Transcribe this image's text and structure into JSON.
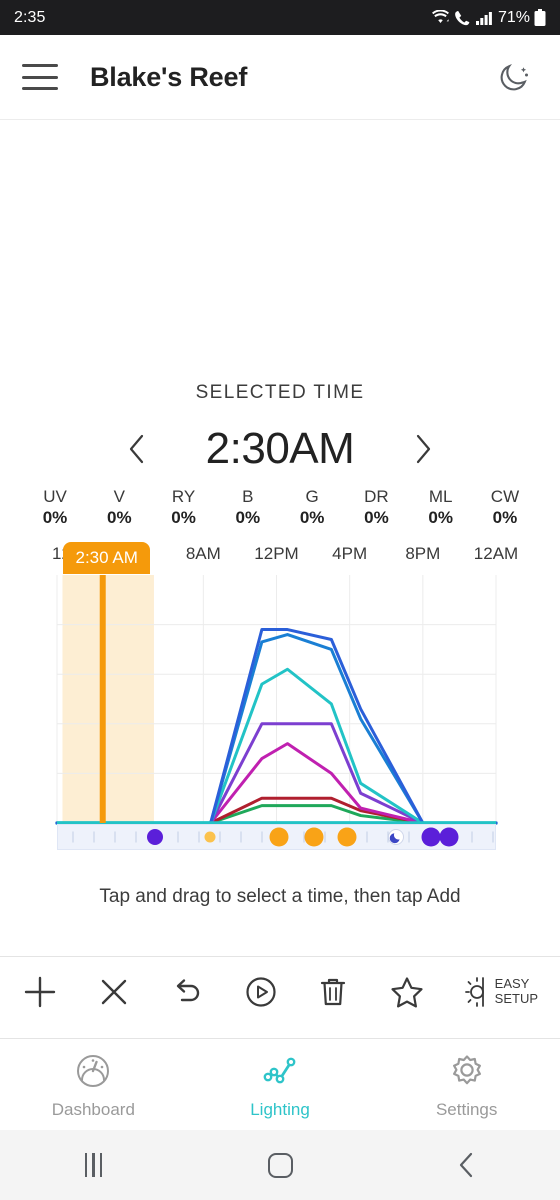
{
  "status_bar": {
    "time": "2:35",
    "battery_pct": "71%",
    "icons": [
      "wifi-icon",
      "call-icon",
      "signal-icon",
      "battery-icon"
    ]
  },
  "app_bar": {
    "menu_icon": "hamburger-menu-icon",
    "title": "Blake's Reef",
    "theme_icon": "moon-icon"
  },
  "selection": {
    "label": "SELECTED TIME",
    "time": "2:30AM",
    "prev_icon": "chevron-left-icon",
    "next_icon": "chevron-right-icon",
    "tooltip": "2:30 AM"
  },
  "channels": [
    {
      "name": "UV",
      "value": "0%",
      "color": "#7c3fd0"
    },
    {
      "name": "V",
      "value": "0%",
      "color": "#9b2fc4"
    },
    {
      "name": "RY",
      "value": "0%",
      "color": "#c0203f"
    },
    {
      "name": "B",
      "value": "0%",
      "color": "#2b5fd9"
    },
    {
      "name": "G",
      "value": "0%",
      "color": "#1fa85a"
    },
    {
      "name": "DR",
      "value": "0%",
      "color": "#b01f2e"
    },
    {
      "name": "ML",
      "value": "0%",
      "color": "#1a7fd4"
    },
    {
      "name": "CW",
      "value": "0%",
      "color": "#22c3c6"
    }
  ],
  "hint_text": "Tap and drag to select a time, then tap Add",
  "toolbar": {
    "add_label": "",
    "items": [
      {
        "name": "add-button",
        "icon": "plus-icon",
        "label": ""
      },
      {
        "name": "close-button",
        "icon": "close-x-icon",
        "label": ""
      },
      {
        "name": "undo-button",
        "icon": "undo-arrow-icon",
        "label": ""
      },
      {
        "name": "preview-button",
        "icon": "play-circle-icon",
        "label": ""
      },
      {
        "name": "delete-button",
        "icon": "trash-icon",
        "label": ""
      },
      {
        "name": "favorite-button",
        "icon": "star-icon",
        "label": ""
      },
      {
        "name": "easy-setup-button",
        "icon": "brightness-icon",
        "label": "EASY SETUP"
      }
    ],
    "easy_setup_line1": "EASY",
    "easy_setup_line2": "SETUP"
  },
  "bottom_nav": {
    "active": "Lighting",
    "accent_color": "#2ec4c9",
    "items": [
      {
        "label": "Dashboard",
        "icon": "gauge-icon",
        "active": false
      },
      {
        "label": "Lighting",
        "icon": "line-chart-icon",
        "active": true
      },
      {
        "label": "Settings",
        "icon": "gear-icon",
        "active": false
      }
    ]
  },
  "android_nav": {
    "recents_icon": "recents-icon",
    "home_icon": "home-icon",
    "back_icon": "back-icon"
  },
  "chart_data": {
    "type": "line",
    "title": "",
    "xlabel": "",
    "ylabel": "",
    "xlim": [
      0,
      24
    ],
    "ylim": [
      0,
      100
    ],
    "grid": true,
    "legend": "none",
    "x_tick_labels": [
      "12...",
      "8AM",
      "12PM",
      "4PM",
      "8PM",
      "12AM"
    ],
    "x_tick_hours": [
      0,
      8,
      12,
      16,
      20,
      24
    ],
    "selected_band": {
      "start_hour": 0.3,
      "end_hour": 5.3,
      "marker_hour": 2.5,
      "color": "#fdeed3",
      "line_color": "#f59a0b"
    },
    "x": [
      0,
      8.4,
      11.2,
      12.6,
      15.0,
      16.6,
      20.0,
      24
    ],
    "series": [
      {
        "name": "B",
        "color": "#2b5fd9",
        "values": [
          0,
          0,
          78,
          78,
          74,
          46,
          0,
          0
        ]
      },
      {
        "name": "ML",
        "color": "#1a7fd4",
        "values": [
          0,
          0,
          73,
          76,
          70,
          42,
          0,
          0
        ]
      },
      {
        "name": "CW",
        "color": "#22c3c6",
        "values": [
          0,
          0,
          56,
          62,
          48,
          16,
          0,
          0
        ]
      },
      {
        "name": "UV",
        "color": "#7c3fd0",
        "values": [
          0,
          0,
          40,
          40,
          40,
          12,
          0,
          0
        ]
      },
      {
        "name": "V",
        "color": "#c020b0",
        "values": [
          0,
          0,
          26,
          32,
          20,
          6,
          0,
          0
        ]
      },
      {
        "name": "DR",
        "color": "#b01f2e",
        "values": [
          0,
          0,
          10,
          10,
          10,
          5,
          0,
          0
        ]
      },
      {
        "name": "G",
        "color": "#1fa85a",
        "values": [
          0,
          0,
          7,
          7,
          7,
          3,
          0,
          0
        ]
      },
      {
        "name": "baseline",
        "color": "#22c3c6",
        "values": [
          0,
          0,
          0,
          0,
          0,
          0,
          0,
          0
        ]
      }
    ],
    "markers": [
      {
        "hour": 5.3,
        "type": "dot",
        "color": "#5b1fd9",
        "size": 16
      },
      {
        "hour": 8.3,
        "type": "dot",
        "color": "#fbc24d",
        "size": 11
      },
      {
        "hour": 12.1,
        "type": "dot",
        "color": "#f9a317",
        "size": 19
      },
      {
        "hour": 14.0,
        "type": "dot",
        "color": "#f9a317",
        "size": 19
      },
      {
        "hour": 15.8,
        "type": "dot",
        "color": "#f9a317",
        "size": 19
      },
      {
        "hour": 18.5,
        "type": "moon",
        "color": "#3b46c4",
        "size": 16
      },
      {
        "hour": 20.4,
        "type": "dot",
        "color": "#5b1fd9",
        "size": 19
      },
      {
        "hour": 21.4,
        "type": "dot",
        "color": "#5b1fd9",
        "size": 19
      }
    ]
  }
}
